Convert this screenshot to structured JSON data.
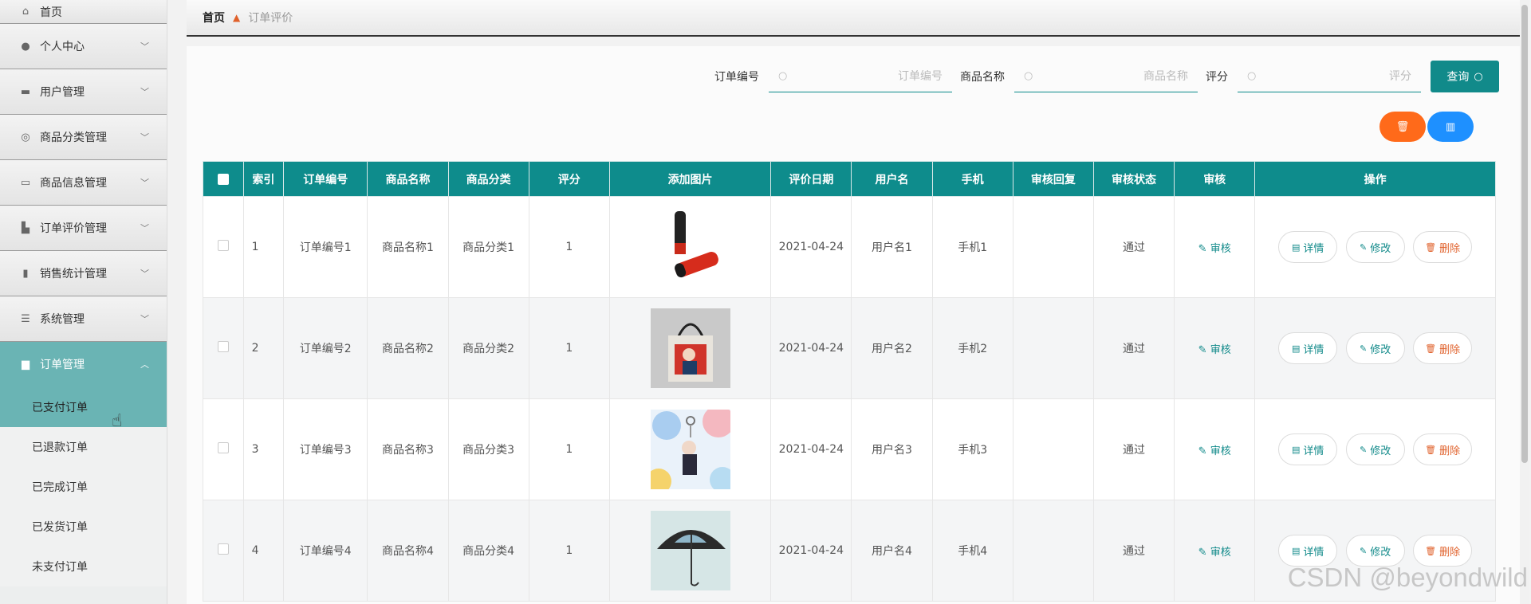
{
  "sidebar": {
    "items": [
      {
        "label": "首页",
        "icon": "home-icon"
      },
      {
        "label": "个人中心",
        "icon": "user-icon"
      },
      {
        "label": "用户管理",
        "icon": "chat-icon"
      },
      {
        "label": "商品分类管理",
        "icon": "circle-icon"
      },
      {
        "label": "商品信息管理",
        "icon": "briefcase-icon"
      },
      {
        "label": "订单评价管理",
        "icon": "thumbs-up-icon"
      },
      {
        "label": "销售统计管理",
        "icon": "bar-chart-icon"
      },
      {
        "label": "系统管理",
        "icon": "sliders-icon"
      },
      {
        "label": "订单管理",
        "icon": "order-icon"
      }
    ],
    "subitems": [
      "已支付订单",
      "已退款订单",
      "已完成订单",
      "已发货订单",
      "未支付订单"
    ]
  },
  "breadcrumb": {
    "home": "首页",
    "current": "订单评价"
  },
  "search": {
    "order_label": "订单编号",
    "order_placeholder": "订单编号",
    "product_label": "商品名称",
    "product_placeholder": "商品名称",
    "score_label": "评分",
    "score_placeholder": "评分",
    "query_label": "查询"
  },
  "table": {
    "headers": [
      "索引",
      "订单编号",
      "商品名称",
      "商品分类",
      "评分",
      "添加图片",
      "评价日期",
      "用户名",
      "手机",
      "审核回复",
      "审核状态",
      "审核",
      "操作"
    ],
    "rows": [
      {
        "index": "1",
        "order": "订单编号1",
        "name": "商品名称1",
        "category": "商品分类1",
        "score": "1",
        "image": "red-thermos-bottle",
        "date": "2021-04-24",
        "user": "用户名1",
        "phone": "手机1",
        "reply": "",
        "status": "通过"
      },
      {
        "index": "2",
        "order": "订单编号2",
        "name": "商品名称2",
        "category": "商品分类2",
        "score": "1",
        "image": "red-tote-bag",
        "date": "2021-04-24",
        "user": "用户名2",
        "phone": "手机2",
        "reply": "",
        "status": "通过"
      },
      {
        "index": "3",
        "order": "订单编号3",
        "name": "商品名称3",
        "category": "商品分类3",
        "score": "1",
        "image": "keychain-figure",
        "date": "2021-04-24",
        "user": "用户名3",
        "phone": "手机3",
        "reply": "",
        "status": "通过"
      },
      {
        "index": "4",
        "order": "订单编号4",
        "name": "商品名称4",
        "category": "商品分类4",
        "score": "1",
        "image": "umbrella",
        "date": "2021-04-24",
        "user": "用户名4",
        "phone": "手机4",
        "reply": "",
        "status": "通过"
      }
    ],
    "audit_label": "审核",
    "detail_label": "详情",
    "edit_label": "修改",
    "delete_label": "删除"
  },
  "watermark": "CSDN @beyondwild",
  "colors": {
    "primary": "#0e8c8c",
    "sidebar_active": "#6ab4b4",
    "danger": "#ff6a1a",
    "info": "#1e90ff"
  }
}
